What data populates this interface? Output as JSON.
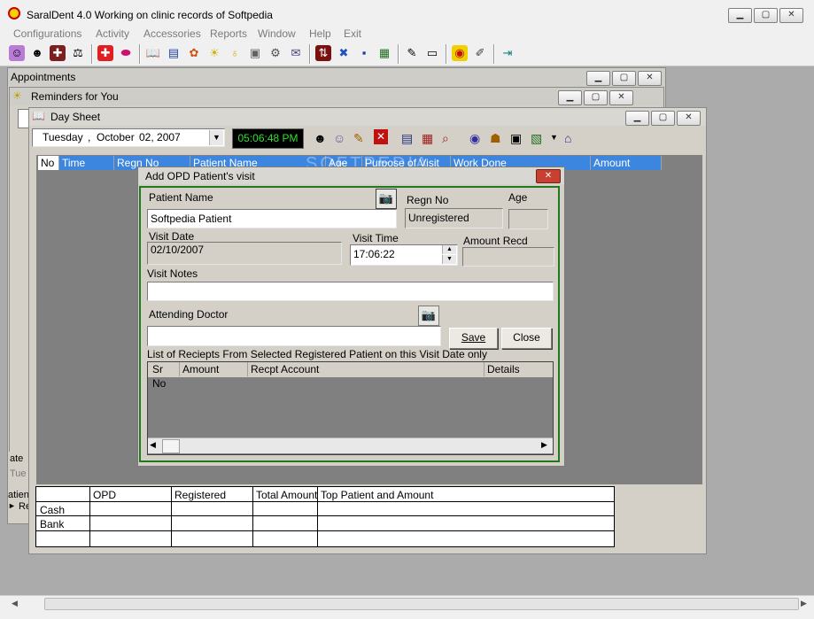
{
  "app": {
    "title": "SaralDent 4.0  Working on clinic records of  Softpedia",
    "menu": [
      "Configurations",
      "Activity",
      "Accessories",
      "Reports",
      "Window",
      "Help",
      "Exit"
    ]
  },
  "toolbar": {
    "icons": [
      "mask-icon",
      "face-icon",
      "doctor-icon",
      "scales-icon",
      "first-aid-icon",
      "pill-icon",
      "book-icon",
      "notes-icon",
      "gift-icon",
      "bulb-icon",
      "bulb-small-icon",
      "medicine-icon",
      "gears-icon",
      "mail-icon",
      "sliders-icon",
      "tools-icon",
      "save-icon",
      "photo-icon",
      "edit-icon",
      "monitor-icon",
      "target-icon",
      "document-icon",
      "exit-icon"
    ]
  },
  "windows": {
    "appointments": {
      "title": "Appointments"
    },
    "reminders": {
      "title": "Reminders for You"
    },
    "day_sheet": {
      "title": "Day Sheet",
      "date": {
        "weekday": "Tuesday",
        "sep": ",",
        "month": "October",
        "day": "02, 2007"
      },
      "clock": "05:06:48 PM",
      "columns": [
        "No",
        "Time",
        "Regn No",
        "Patient Name",
        "Age",
        "Purpose of Visit",
        "Work Done",
        "Amount"
      ],
      "summary": {
        "columns": [
          "OPD",
          "Registered",
          "Total Amount",
          "Top Patient and Amount"
        ],
        "rows": [
          "Cash",
          "Bank",
          ""
        ]
      }
    },
    "left_panel": {
      "label_date": "ate",
      "value_day": "Tue",
      "label_patient": "atien",
      "marker": "►",
      "sub": "Re"
    }
  },
  "dialog": {
    "title": "Add  OPD  Patient's visit",
    "patient_name_label": "Patient Name",
    "patient_name_value": "Softpedia  Patient",
    "regn_no_label": "Regn No",
    "regn_no_value": "Unregistered",
    "age_label": "Age",
    "age_value": "",
    "visit_date_label": "Visit Date",
    "visit_date_value": "02/10/2007",
    "visit_time_label": "Visit Time",
    "visit_time_value": "17:06:22",
    "amount_label": "Amount Recd",
    "amount_value": "",
    "notes_label": "Visit Notes",
    "notes_value": "",
    "doctor_label": "Attending Doctor",
    "doctor_value": "",
    "save_label": "Save",
    "close_label": "Close",
    "receipts_label": "List of Reciepts From Selected Registered Patient on this Visit Date only",
    "receipt_columns": [
      "Sr No",
      "Amount",
      "Recpt Account",
      "Details"
    ]
  },
  "watermark": "SOFTPEDIA"
}
